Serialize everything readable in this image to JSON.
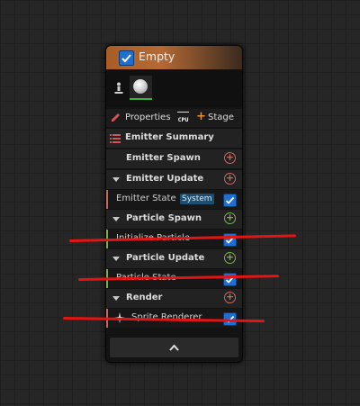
{
  "node": {
    "title": "Empty",
    "toolbar": {
      "properties_label": "Properties",
      "cpu_label": "CPU",
      "stage_label": "Stage"
    },
    "rows": {
      "emitter_summary": "Emitter Summary",
      "emitter_spawn": "Emitter Spawn",
      "emitter_update": "Emitter Update",
      "emitter_state": "Emitter State",
      "emitter_state_badge": "System",
      "particle_spawn": "Particle Spawn",
      "initialize_particle": "Initialize Particle",
      "particle_update": "Particle Update",
      "particle_state": "Particle State",
      "render": "Render",
      "sprite_renderer": "Sprite Renderer"
    }
  },
  "colors": {
    "header_accent": "#b56a33",
    "checkbox_blue": "#1f6fd1",
    "emitter_plus": "#c8685c",
    "particle_plus": "#7ab04c",
    "strike_red": "#e31414",
    "thumbnail_selected_underline": "#3fb13f"
  },
  "icons": {
    "enable_checkbox": "checkmark-icon",
    "thumbnail_left": "person-pin-icon",
    "thumbnail_right": "sphere-icon",
    "properties": "pencil-icon",
    "stage_add": "plus-icon",
    "summary": "list-icon",
    "section_collapse": "triangle-down-icon",
    "add_module": "plus-circle-icon",
    "sprite": "sprite-icon",
    "collapse_node": "chevron-up-icon"
  }
}
